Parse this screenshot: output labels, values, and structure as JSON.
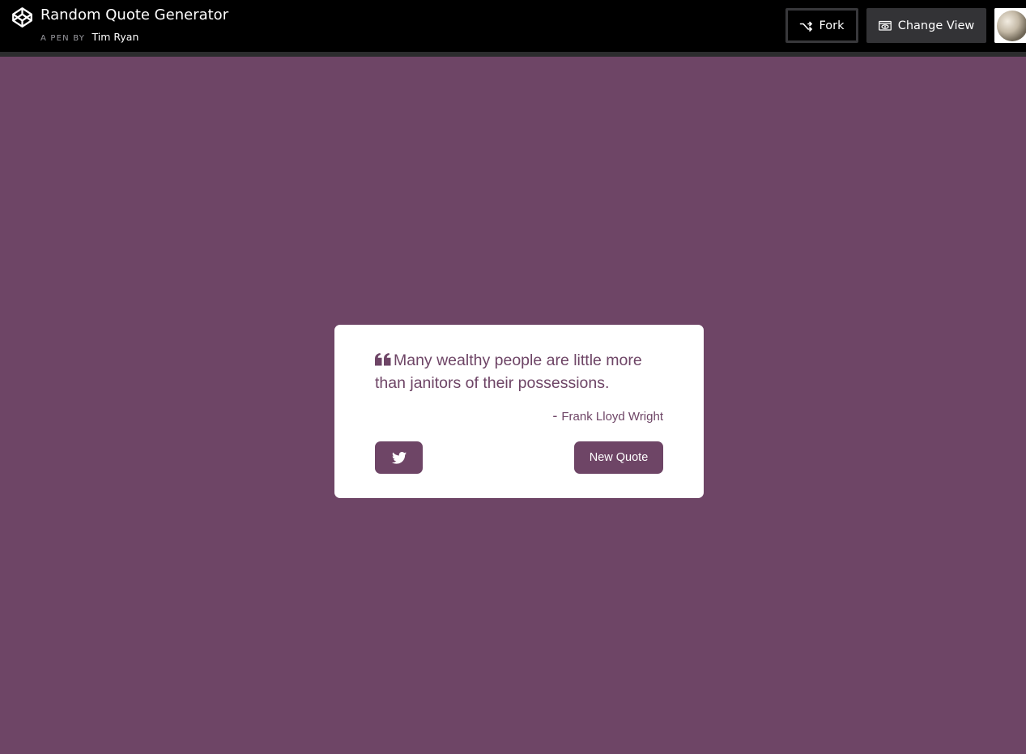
{
  "header": {
    "title": "Random Quote Generator",
    "pen_by_label": "A PEN BY",
    "author": "Tim Ryan",
    "fork_label": "Fork",
    "change_view_label": "Change View",
    "logo_icon": "codepen-logo-icon",
    "avatar": "user-avatar"
  },
  "quote_box": {
    "text": "Many wealthy people are little more than janitors of their possessions.",
    "dash": "-",
    "author": "Frank Lloyd Wright",
    "tweet_icon": "twitter-icon",
    "new_quote_label": "New Quote"
  },
  "colors": {
    "accent": "#6e4566",
    "topbar_bg": "#000000",
    "card_bg": "#ffffff",
    "button_secondary_bg": "#333336"
  }
}
